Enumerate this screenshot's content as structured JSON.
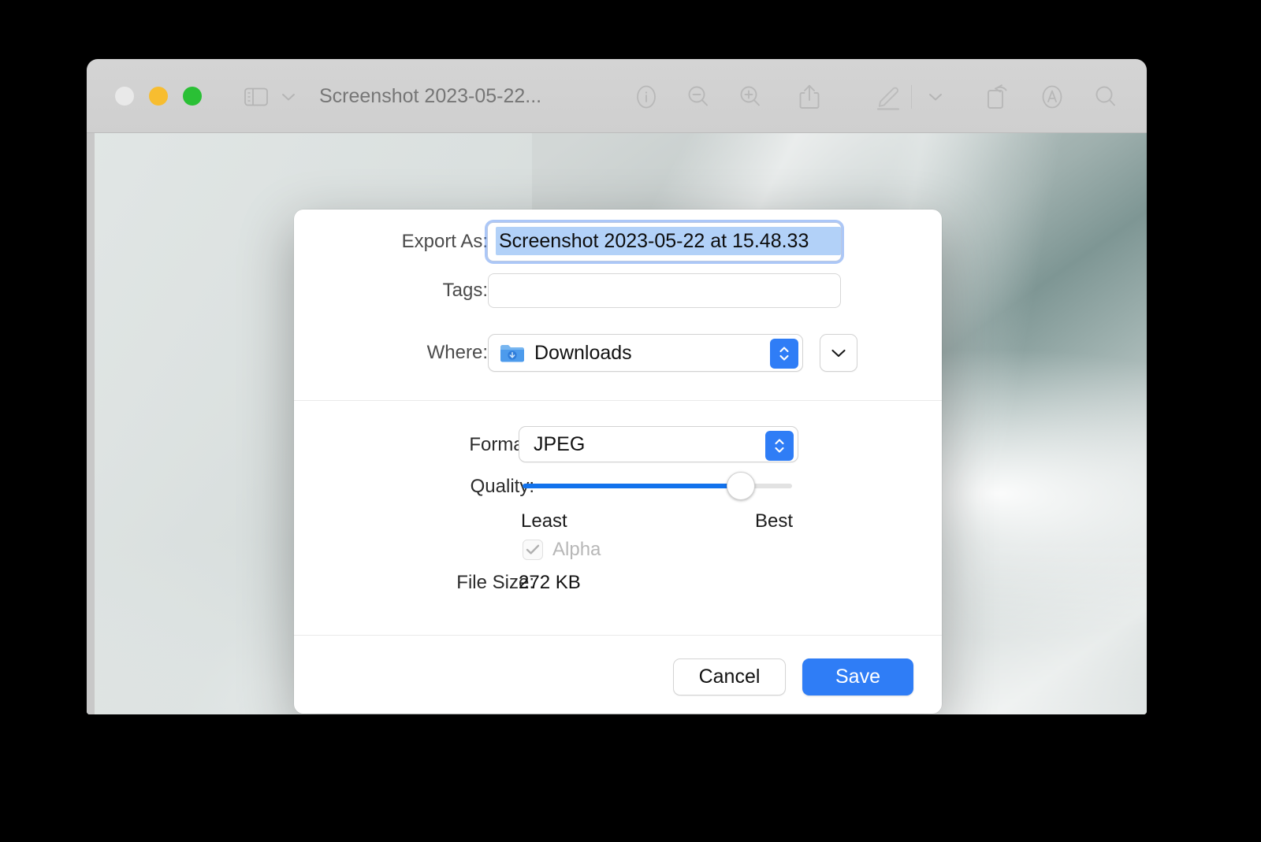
{
  "window": {
    "title": "Screenshot 2023-05-22...",
    "traffic_lights": [
      {
        "name": "close",
        "color": "#e9e9e9"
      },
      {
        "name": "minimize",
        "color": "#f7bd30"
      },
      {
        "name": "maximize",
        "color": "#2ac035"
      }
    ],
    "toolbar_icons": [
      "sidebar-toggle-icon",
      "chevron-down-icon",
      "info-icon",
      "zoom-out-icon",
      "zoom-in-icon",
      "share-icon",
      "markup-pen-icon",
      "chevron-down-icon",
      "rotate-icon",
      "annotate-icon",
      "search-icon"
    ]
  },
  "dialog": {
    "export_as": {
      "label": "Export As:",
      "value": "Screenshot 2023-05-22 at 15.48.33",
      "selected": true
    },
    "tags": {
      "label": "Tags:",
      "value": "",
      "placeholder": ""
    },
    "where": {
      "label": "Where:",
      "value": "Downloads",
      "icon": "downloads-folder-icon"
    },
    "format": {
      "label": "Format:",
      "value": "JPEG"
    },
    "quality": {
      "label": "Quality:",
      "percent": 81,
      "least_label": "Least",
      "best_label": "Best"
    },
    "alpha": {
      "label": "Alpha",
      "checked": true,
      "disabled": true
    },
    "file_size": {
      "label": "File Size:",
      "value": "272 KB"
    },
    "buttons": {
      "cancel": "Cancel",
      "save": "Save"
    }
  },
  "colors": {
    "accent": "#2f7df6",
    "slider_fill": "#1272ec",
    "selection": "#b2d1f8",
    "titlebar": "#d2d2d2",
    "dialog_bg": "#ffffff",
    "disabled_text": "#b7b7b7"
  }
}
